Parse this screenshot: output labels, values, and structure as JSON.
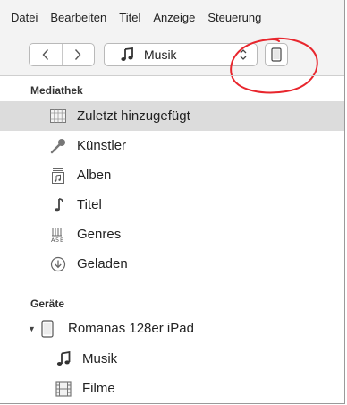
{
  "menubar": {
    "items": [
      "Datei",
      "Bearbeiten",
      "Titel",
      "Anzeige",
      "Steuerung"
    ]
  },
  "toolbar": {
    "back_icon": "chevron-left-icon",
    "forward_icon": "chevron-right-icon",
    "media_selector": {
      "icon": "music-note-icon",
      "label": "Musik"
    },
    "device_button_icon": "ipad-icon"
  },
  "sidebar": {
    "library": {
      "heading": "Mediathek",
      "items": [
        {
          "label": "Zuletzt hinzugefügt",
          "icon": "grid-icon",
          "selected": true
        },
        {
          "label": "Künstler",
          "icon": "microphone-icon"
        },
        {
          "label": "Alben",
          "icon": "album-icon"
        },
        {
          "label": "Titel",
          "icon": "music-note-icon"
        },
        {
          "label": "Genres",
          "icon": "genres-icon"
        },
        {
          "label": "Geladen",
          "icon": "download-icon"
        }
      ]
    },
    "devices": {
      "heading": "Geräte",
      "device": {
        "label": "Romanas 128er iPad",
        "icon": "ipad-icon",
        "expanded": true
      },
      "children": [
        {
          "label": "Musik",
          "icon": "music-note-icon"
        },
        {
          "label": "Filme",
          "icon": "film-icon"
        }
      ]
    }
  },
  "colors": {
    "toolbar_bg": "#f3f3f3",
    "selected_row": "#dcdcdc",
    "annotation": "#e8262d"
  }
}
